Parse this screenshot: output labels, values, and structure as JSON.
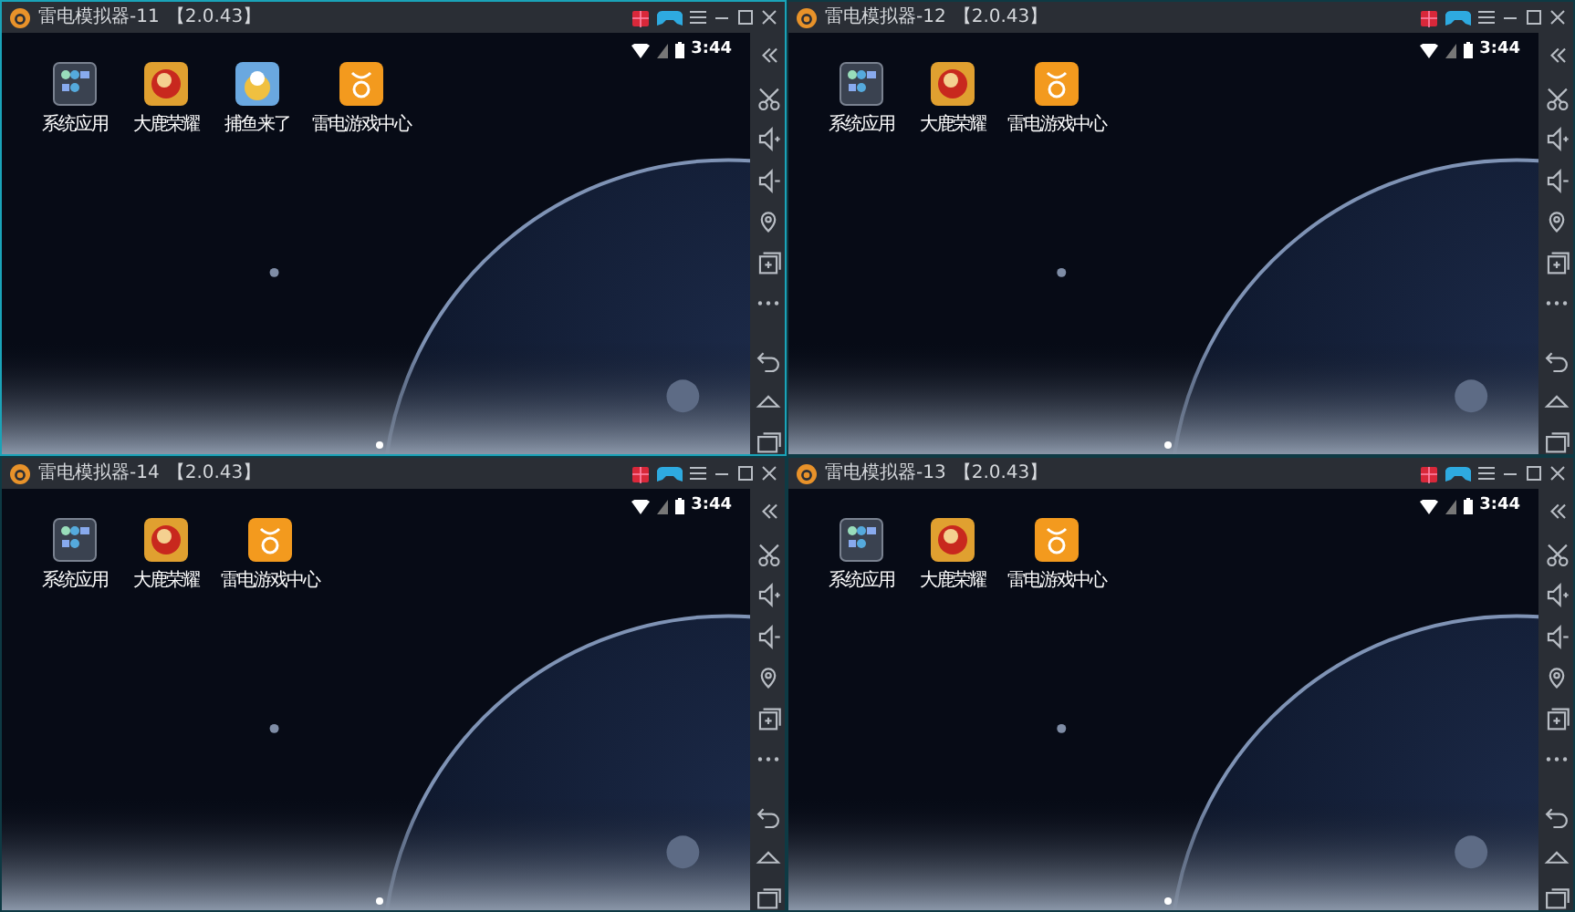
{
  "windows": [
    {
      "title": "雷电模拟器-11",
      "version": "【2.0.43】",
      "active": true,
      "time": "3:44",
      "apps": [
        {
          "label": "系统应用",
          "kind": "folder"
        },
        {
          "label": "大鹿荣耀",
          "kind": "game-red"
        },
        {
          "label": "捕鱼来了",
          "kind": "game-blue"
        },
        {
          "label": "雷电游戏中心",
          "kind": "store"
        }
      ]
    },
    {
      "title": "雷电模拟器-12",
      "version": "【2.0.43】",
      "active": false,
      "time": "3:44",
      "apps": [
        {
          "label": "系统应用",
          "kind": "folder"
        },
        {
          "label": "大鹿荣耀",
          "kind": "game-red"
        },
        {
          "label": "雷电游戏中心",
          "kind": "store"
        }
      ]
    },
    {
      "title": "雷电模拟器-14",
      "version": "【2.0.43】",
      "active": false,
      "time": "3:44",
      "apps": [
        {
          "label": "系统应用",
          "kind": "folder"
        },
        {
          "label": "大鹿荣耀",
          "kind": "game-red"
        },
        {
          "label": "雷电游戏中心",
          "kind": "store"
        }
      ]
    },
    {
      "title": "雷电模拟器-13",
      "version": "【2.0.43】",
      "active": false,
      "time": "3:44",
      "apps": [
        {
          "label": "系统应用",
          "kind": "folder"
        },
        {
          "label": "大鹿荣耀",
          "kind": "game-red"
        },
        {
          "label": "雷电游戏中心",
          "kind": "store"
        }
      ]
    }
  ]
}
